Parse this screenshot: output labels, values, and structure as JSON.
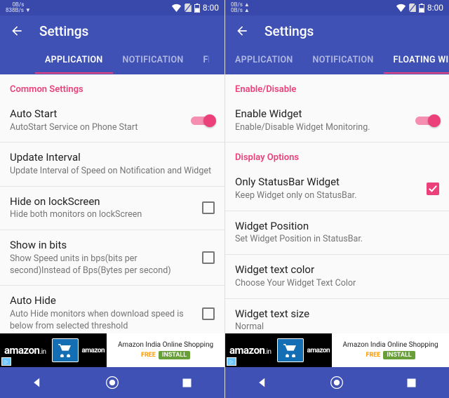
{
  "status": {
    "time": "8:00",
    "net1": "0B/s",
    "net2": "838B/s ▼",
    "net3": "0B/s ▲",
    "net4": "0B/s ▲"
  },
  "header": {
    "title": "Settings"
  },
  "tabs": {
    "left": [
      {
        "label": "APPLICATION",
        "active": true
      },
      {
        "label": "NOTIFICATION",
        "active": false
      },
      {
        "label": "FL",
        "active": false
      }
    ],
    "right": [
      {
        "label": "APPLICATION",
        "active": false
      },
      {
        "label": "NOTIFICATION",
        "active": false
      },
      {
        "label": "FLOATING WIDGET",
        "active": true
      }
    ]
  },
  "left": {
    "sections": [
      {
        "head": "Common Settings",
        "items": [
          {
            "title": "Auto Start",
            "sub": "AutoStart Service on Phone Start",
            "ctl": "switch",
            "value": true
          },
          {
            "title": "Update Interval",
            "sub": "Update Interval of Speed on Notification and Widget",
            "ctl": "none"
          },
          {
            "title": "Hide on lockScreen",
            "sub": "Hide both monitors on lockScreen",
            "ctl": "check",
            "value": false
          },
          {
            "title": "Show in bits",
            "sub": "Show Speed units in bps(bits per second)Instead of Bps(Bytes per second)",
            "ctl": "check",
            "value": false
          },
          {
            "title": "Auto Hide",
            "sub": "Auto Hide monitors when download speed is below from selected threshold",
            "ctl": "check",
            "value": false
          }
        ]
      }
    ]
  },
  "right": {
    "sections": [
      {
        "head": "Enable/Disable",
        "items": [
          {
            "title": "Enable Widget",
            "sub": "Enable/Disable Widget Monitoring.",
            "ctl": "switch",
            "value": true
          }
        ]
      },
      {
        "head": "Display Options",
        "items": [
          {
            "title": "Only StatusBar Widget",
            "sub": "Keep Widget only on StatusBar.",
            "ctl": "check",
            "value": true
          },
          {
            "title": "Widget Position",
            "sub": "Set Widget Position in StatusBar.",
            "ctl": "none"
          },
          {
            "title": "Widget text color",
            "sub": "Choose Your Widget Text Color",
            "ctl": "none"
          },
          {
            "title": "Widget text size",
            "sub": "Normal",
            "ctl": "none"
          }
        ]
      }
    ]
  },
  "ad": {
    "brand": "amazon",
    "domain": ".in",
    "text": "Amazon India Online Shopping",
    "free": "FREE",
    "install": "INSTALL"
  }
}
